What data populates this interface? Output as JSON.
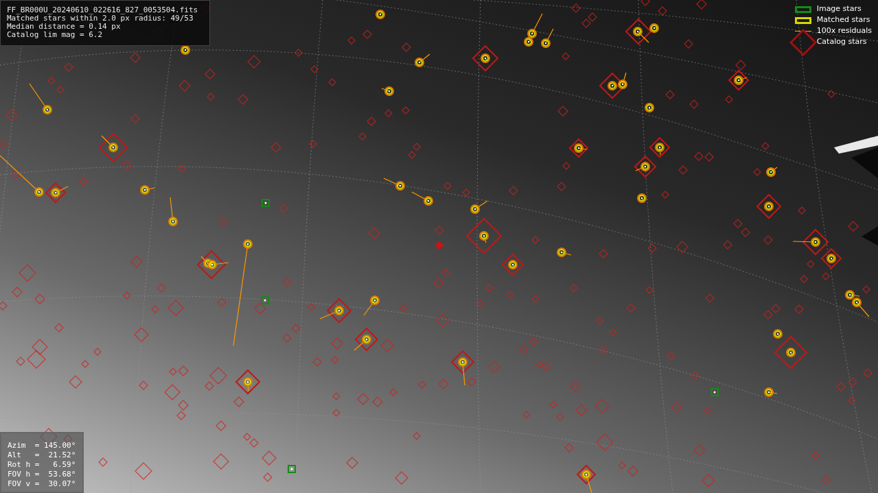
{
  "file_info": [
    "FF_BR000U_20240610_022616_827_0053504.fits",
    "Matched stars within 2.0 px radius: 49/53",
    "Median distance = 0.14 px",
    "Catalog lim mag = 6.2"
  ],
  "legend": [
    {
      "label": "Image stars",
      "kind": "image"
    },
    {
      "label": "Matched stars",
      "kind": "matched"
    },
    {
      "label": "100x residuals",
      "kind": "residual"
    },
    {
      "label": "Catalog stars",
      "kind": "catalog"
    }
  ],
  "pointing": [
    "Azim  = 145.00°",
    "Alt   =  21.52°",
    "Rot h =   6.59°",
    "FOV h =  53.68°",
    "FOV v =  30.07°"
  ]
}
